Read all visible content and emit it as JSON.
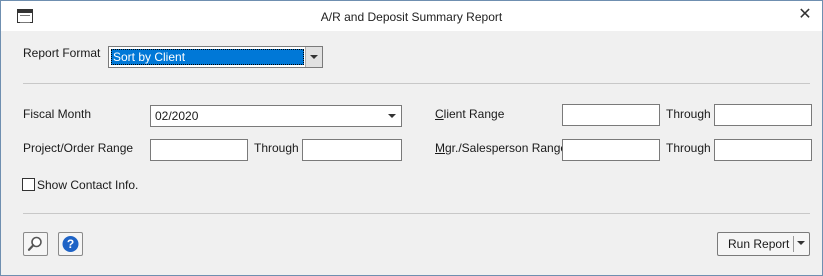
{
  "window": {
    "title": "A/R and Deposit Summary Report"
  },
  "report_format": {
    "label": "Report Format",
    "value": "Sort by Client"
  },
  "fiscal_month": {
    "label": "Fiscal Month",
    "value": "02/2020"
  },
  "project_order_range": {
    "label": "Project/Order Range",
    "through_label": "Through",
    "from": "",
    "to": ""
  },
  "client_range": {
    "label_underlined": "C",
    "label_rest": "lient Range",
    "through_label": "Through",
    "from": "",
    "to": ""
  },
  "mgr_salesperson_range": {
    "label_underlined": "M",
    "label_rest": "gr./Salesperson Range",
    "through_label": "Through",
    "from": "",
    "to": ""
  },
  "show_contact": {
    "label": "Show Contact Info.",
    "checked": false
  },
  "footer": {
    "run_label": "Run Report"
  },
  "colors": {
    "accent": "#0078d7",
    "help": "#1e63c6",
    "border": "#6f8fb0"
  }
}
